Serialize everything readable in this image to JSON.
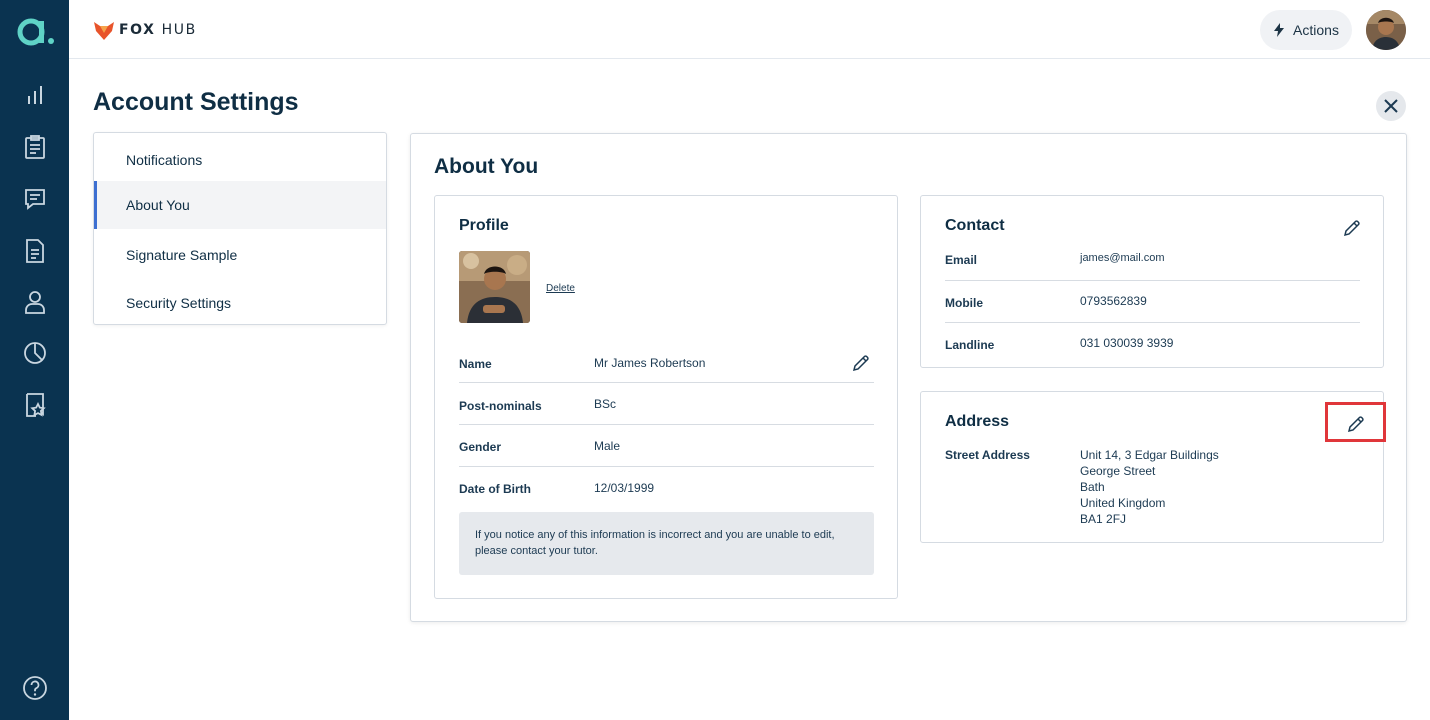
{
  "app": {
    "rail_logo_glyph": "a.",
    "brand_fox": "FOX",
    "brand_hub": "HUB",
    "accent_color": "#3d6fd1",
    "rail_color": "#0a3350",
    "brand_color": "#e8542b"
  },
  "rail": {
    "icons": [
      "analytics-icon",
      "clipboard-icon",
      "chat-icon",
      "document-icon",
      "user-icon",
      "pie-chart-icon",
      "badge-icon"
    ],
    "help_icon": "help-icon"
  },
  "header": {
    "actions_label": "Actions",
    "actions_icon": "lightning-icon"
  },
  "page": {
    "title": "Account Settings"
  },
  "side_nav": {
    "items": [
      {
        "label": "Notifications"
      },
      {
        "label": "About You"
      },
      {
        "label": "Signature Sample"
      },
      {
        "label": "Security Settings"
      }
    ],
    "active": "About You"
  },
  "about": {
    "title": "About You",
    "profile": {
      "title": "Profile",
      "delete_label": "Delete",
      "rows": [
        {
          "label": "Name",
          "value": "Mr James Robertson"
        },
        {
          "label": "Post-nominals",
          "value": "BSc"
        },
        {
          "label": "Gender",
          "value": "Male"
        },
        {
          "label": "Date of Birth",
          "value": "12/03/1999"
        }
      ],
      "notice": "If you notice any of this information is incorrect and you are unable to edit, please contact your tutor."
    },
    "contact": {
      "title": "Contact",
      "rows": [
        {
          "label": "Email",
          "value": "james@mail.com"
        },
        {
          "label": "Mobile",
          "value": "0793562839"
        },
        {
          "label": "Landline",
          "value": "031 030039 3939"
        }
      ]
    },
    "address": {
      "title": "Address",
      "label": "Street Address",
      "lines": [
        "Unit 14, 3 Edgar Buildings",
        "George Street",
        "Bath",
        "United Kingdom",
        "BA1 2FJ"
      ]
    }
  }
}
